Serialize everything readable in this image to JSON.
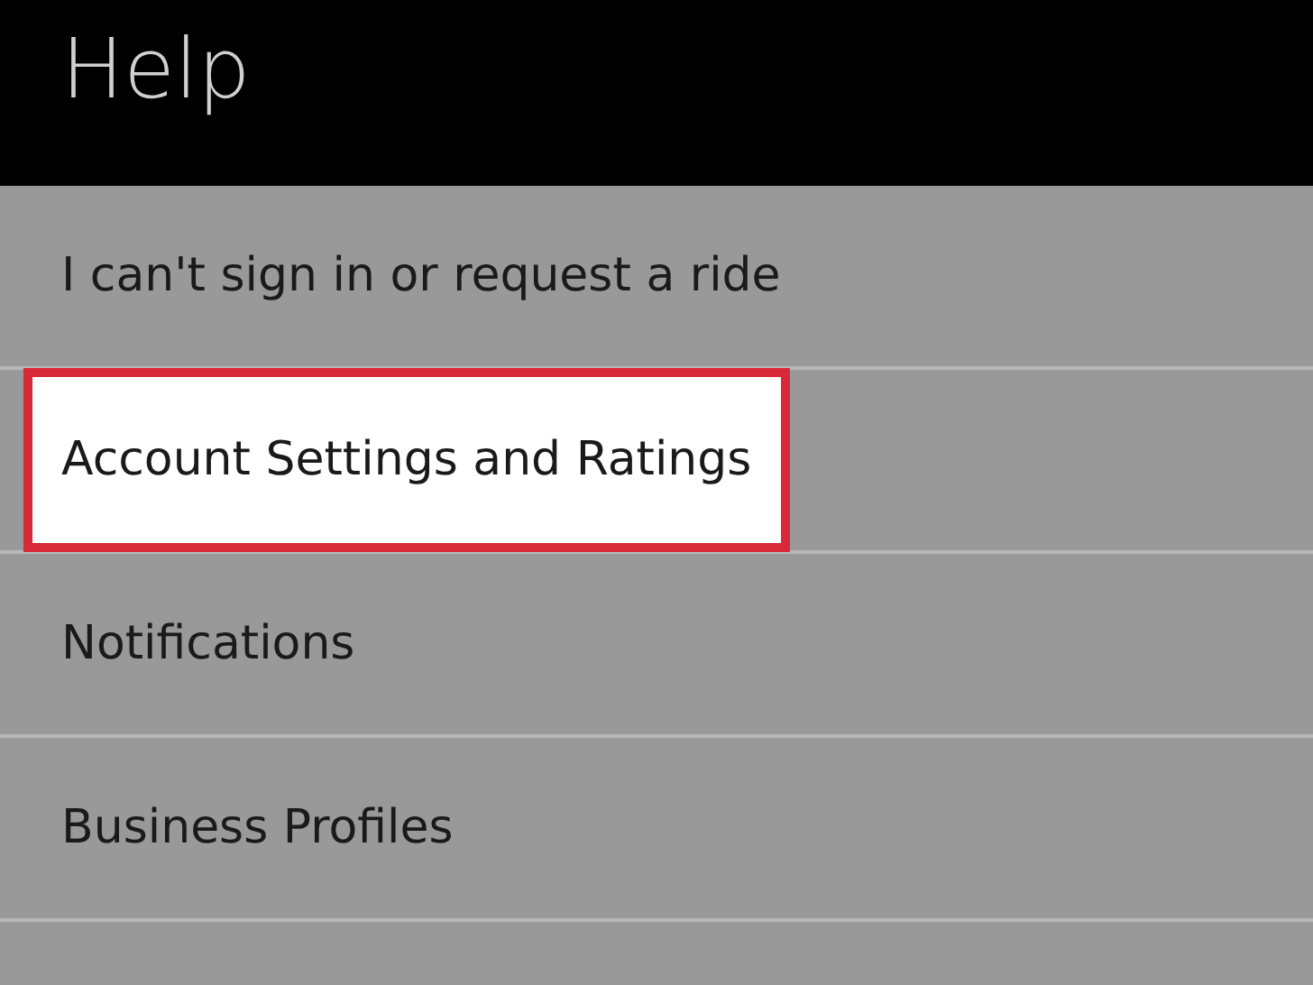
{
  "header": {
    "title": "Help"
  },
  "items": [
    {
      "label": "I can't sign in or request a ride",
      "highlighted": false
    },
    {
      "label": "Account Settings and Ratings",
      "highlighted": true
    },
    {
      "label": "Notifications",
      "highlighted": false
    },
    {
      "label": "Business Profiles",
      "highlighted": false
    }
  ]
}
